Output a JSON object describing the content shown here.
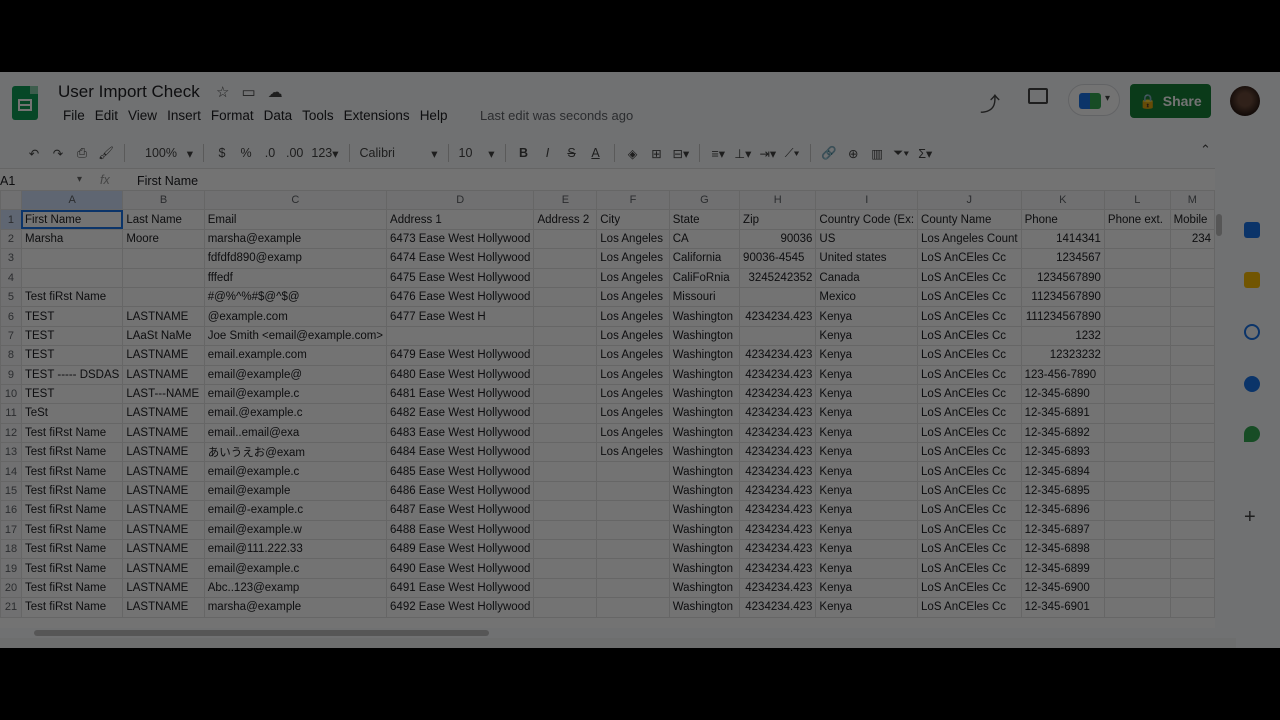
{
  "doc": {
    "title": "User Import Check",
    "menu": [
      "File",
      "Edit",
      "View",
      "Insert",
      "Format",
      "Data",
      "Tools",
      "Extensions",
      "Help"
    ],
    "last_edit": "Last edit was seconds ago",
    "share_label": "Share"
  },
  "toolbar": {
    "zoom": "100%",
    "currency": "$",
    "percent": "%",
    "dec_decrease": ".0",
    "dec_increase": ".00",
    "number_format": "123",
    "font": "Calibri",
    "font_size": "10",
    "bold": "B",
    "italic": "I",
    "strike": "S",
    "text_color": "A"
  },
  "formula_bar": {
    "cell_ref": "A1",
    "fx": "fx",
    "value": "First Name"
  },
  "columns": [
    "A",
    "B",
    "C",
    "D",
    "E",
    "F",
    "G",
    "H",
    "I",
    "J",
    "K",
    "L",
    "M"
  ],
  "rows": [
    [
      "First Name",
      "Last Name",
      "Email",
      "Address 1",
      "Address 2",
      "City",
      "State",
      "Zip",
      "Country Code (Ex:",
      "County Name",
      "Phone",
      "Phone ext.",
      "Mobile"
    ],
    [
      "Marsha",
      "Moore",
      "marsha@example",
      "6473 Ease West Hollywood",
      "",
      "Los Angeles",
      "CA",
      "90036",
      "US",
      "Los Angeles Count",
      "1414341",
      "",
      "234"
    ],
    [
      "",
      "",
      "fdfdfd890@examp",
      "6474 Ease West Hollywood",
      "",
      "Los Angeles",
      "California",
      "90036-4545",
      "United states",
      "LoS AnCEles Cc",
      "1234567",
      "",
      ""
    ],
    [
      "",
      "",
      "fffedf",
      "6475 Ease West Hollywood",
      "",
      "Los Angeles",
      "CaliFoRnia",
      "3245242352",
      "Canada",
      "LoS AnCEles Cc",
      "1234567890",
      "",
      ""
    ],
    [
      "Test fiRst Name",
      "",
      "#@%^%#$@^$@",
      "6476 Ease West Hollywood",
      "",
      "Los Angeles",
      "Missouri",
      "",
      "Mexico",
      "LoS AnCEles Cc",
      "11234567890",
      "",
      ""
    ],
    [
      "TEST",
      "LASTNAME",
      "@example.com",
      "6477 Ease West H",
      "",
      "Los Angeles",
      "Washington",
      "4234234.423",
      "Kenya",
      "LoS AnCEles Cc",
      "111234567890",
      "",
      ""
    ],
    [
      "TEST",
      "LAaSt NaMe",
      "Joe Smith <email@example.com>",
      "",
      "",
      "Los Angeles",
      "Washington",
      "",
      "Kenya",
      "LoS AnCEles Cc",
      "1232",
      "",
      ""
    ],
    [
      "TEST",
      "LASTNAME",
      "email.example.com",
      "6479 Ease West Hollywood",
      "",
      "Los Angeles",
      "Washington",
      "4234234.423",
      "Kenya",
      "LoS AnCEles Cc",
      "12323232",
      "",
      ""
    ],
    [
      "TEST ----- DSDAS",
      "LASTNAME",
      "email@example@",
      "6480 Ease West Hollywood",
      "",
      "Los Angeles",
      "Washington",
      "4234234.423",
      "Kenya",
      "LoS AnCEles Cc",
      "123-456-7890",
      "",
      ""
    ],
    [
      "TEST",
      "LAST---NAME",
      "email@example.c",
      "6481 Ease West Hollywood",
      "",
      "Los Angeles",
      "Washington",
      "4234234.423",
      "Kenya",
      "LoS AnCEles Cc",
      "12-345-6890",
      "",
      ""
    ],
    [
      "TeSt",
      "LASTNAME",
      "email.@example.c",
      "6482 Ease West Hollywood",
      "",
      "Los Angeles",
      "Washington",
      "4234234.423",
      "Kenya",
      "LoS AnCEles Cc",
      "12-345-6891",
      "",
      ""
    ],
    [
      "Test fiRst Name",
      "LASTNAME",
      "email..email@exa",
      "6483 Ease West Hollywood",
      "",
      "Los Angeles",
      "Washington",
      "4234234.423",
      "Kenya",
      "LoS AnCEles Cc",
      "12-345-6892",
      "",
      ""
    ],
    [
      "Test fiRst Name",
      "LASTNAME",
      "あいうえお@exam",
      "6484 Ease West Hollywood",
      "",
      "Los Angeles",
      "Washington",
      "4234234.423",
      "Kenya",
      "LoS AnCEles Cc",
      "12-345-6893",
      "",
      ""
    ],
    [
      "Test fiRst Name",
      "LASTNAME",
      "email@example.c",
      "6485 Ease West Hollywood",
      "",
      "",
      "Washington",
      "4234234.423",
      "Kenya",
      "LoS AnCEles Cc",
      "12-345-6894",
      "",
      ""
    ],
    [
      "Test fiRst Name",
      "LASTNAME",
      "email@example",
      "6486 Ease West Hollywood",
      "",
      "",
      "Washington",
      "4234234.423",
      "Kenya",
      "LoS AnCEles Cc",
      "12-345-6895",
      "",
      ""
    ],
    [
      "Test fiRst Name",
      "LASTNAME",
      "email@-example.c",
      "6487 Ease West Hollywood",
      "",
      "",
      "Washington",
      "4234234.423",
      "Kenya",
      "LoS AnCEles Cc",
      "12-345-6896",
      "",
      ""
    ],
    [
      "Test fiRst Name",
      "LASTNAME",
      "email@example.w",
      "6488 Ease West Hollywood",
      "",
      "",
      "Washington",
      "4234234.423",
      "Kenya",
      "LoS AnCEles Cc",
      "12-345-6897",
      "",
      ""
    ],
    [
      "Test fiRst Name",
      "LASTNAME",
      "email@111.222.33",
      "6489 Ease West Hollywood",
      "",
      "",
      "Washington",
      "4234234.423",
      "Kenya",
      "LoS AnCEles Cc",
      "12-345-6898",
      "",
      ""
    ],
    [
      "Test fiRst Name",
      "LASTNAME",
      "email@example.c",
      "6490 Ease West Hollywood",
      "",
      "",
      "Washington",
      "4234234.423",
      "Kenya",
      "LoS AnCEles Cc",
      "12-345-6899",
      "",
      ""
    ],
    [
      "Test fiRst Name",
      "LASTNAME",
      "Abc..123@examp",
      "6491 Ease West Hollywood",
      "",
      "",
      "Washington",
      "4234234.423",
      "Kenya",
      "LoS AnCEles Cc",
      "12-345-6900",
      "",
      ""
    ],
    [
      "Test fiRst Name",
      "LASTNAME",
      "marsha@example",
      "6492 Ease West Hollywood",
      "",
      "",
      "Washington",
      "4234234.423",
      "Kenya",
      "LoS AnCEles Cc",
      "12-345-6901",
      "",
      ""
    ]
  ],
  "colors": {
    "share": "#188038",
    "sheets_green": "#0f9d58",
    "selection": "#1a73e8"
  }
}
